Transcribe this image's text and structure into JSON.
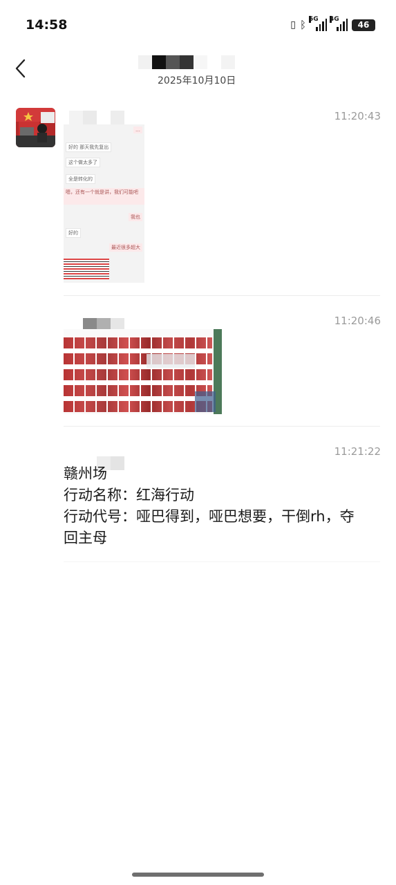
{
  "status_bar": {
    "time": "14:58",
    "battery": "46",
    "net1": "5G",
    "net2": "4G"
  },
  "header": {
    "date": "2025年10月10日"
  },
  "messages": [
    {
      "time": "11:20:43",
      "type": "image"
    },
    {
      "time": "11:20:46",
      "type": "image"
    },
    {
      "time": "11:21:22",
      "type": "text",
      "text": "赣州场\n行动名称：红海行动\n行动代号：哑巴得到，哑巴想要，干倒rh，夺回主母"
    }
  ],
  "thumb1": {
    "lines": [
      "好的 那天我先复出",
      "这个做太多了",
      "全是转化的",
      "嗯，还有一个就是讲，我们可能吧",
      "我也",
      "好的",
      "最近很多超大"
    ]
  },
  "colors": {
    "accent_red": "#c62828",
    "home_bar": "#6f6f6f"
  }
}
